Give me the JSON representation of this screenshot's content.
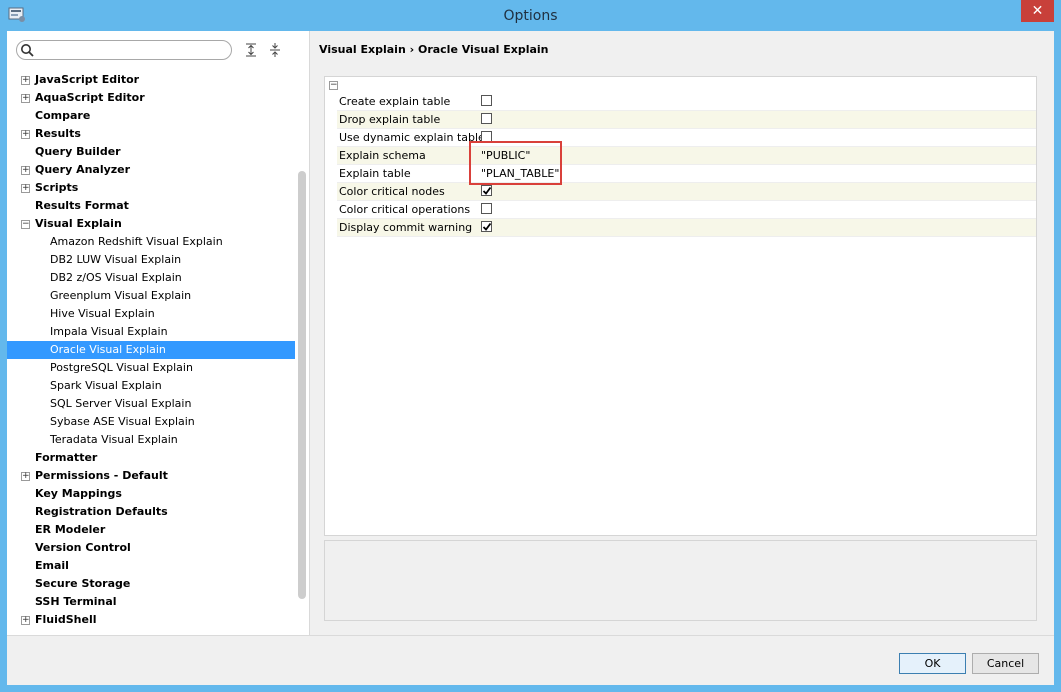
{
  "window": {
    "title": "Options",
    "close_glyph": "✕"
  },
  "search": {
    "placeholder": "",
    "value": ""
  },
  "tree": [
    {
      "label": "JavaScript Editor",
      "level": 0,
      "expander": "+"
    },
    {
      "label": "AquaScript Editor",
      "level": 0,
      "expander": "+"
    },
    {
      "label": "Compare",
      "level": 0,
      "expander": ""
    },
    {
      "label": "Results",
      "level": 0,
      "expander": "+"
    },
    {
      "label": "Query Builder",
      "level": 0,
      "expander": ""
    },
    {
      "label": "Query Analyzer",
      "level": 0,
      "expander": "+"
    },
    {
      "label": "Scripts",
      "level": 0,
      "expander": "+"
    },
    {
      "label": "Results Format",
      "level": 0,
      "expander": ""
    },
    {
      "label": "Visual Explain",
      "level": 0,
      "expander": "−"
    },
    {
      "label": "Amazon Redshift Visual Explain",
      "level": 1,
      "expander": ""
    },
    {
      "label": "DB2 LUW Visual Explain",
      "level": 1,
      "expander": ""
    },
    {
      "label": "DB2 z/OS Visual Explain",
      "level": 1,
      "expander": ""
    },
    {
      "label": "Greenplum Visual Explain",
      "level": 1,
      "expander": ""
    },
    {
      "label": "Hive Visual Explain",
      "level": 1,
      "expander": ""
    },
    {
      "label": "Impala Visual Explain",
      "level": 1,
      "expander": ""
    },
    {
      "label": "Oracle Visual Explain",
      "level": 1,
      "expander": "",
      "selected": true
    },
    {
      "label": "PostgreSQL Visual Explain",
      "level": 1,
      "expander": ""
    },
    {
      "label": "Spark Visual Explain",
      "level": 1,
      "expander": ""
    },
    {
      "label": "SQL Server Visual Explain",
      "level": 1,
      "expander": ""
    },
    {
      "label": "Sybase ASE Visual Explain",
      "level": 1,
      "expander": ""
    },
    {
      "label": "Teradata Visual Explain",
      "level": 1,
      "expander": ""
    },
    {
      "label": "Formatter",
      "level": 0,
      "expander": ""
    },
    {
      "label": "Permissions - Default",
      "level": 0,
      "expander": "+"
    },
    {
      "label": "Key Mappings",
      "level": 0,
      "expander": ""
    },
    {
      "label": "Registration Defaults",
      "level": 0,
      "expander": ""
    },
    {
      "label": "ER Modeler",
      "level": 0,
      "expander": ""
    },
    {
      "label": "Version Control",
      "level": 0,
      "expander": ""
    },
    {
      "label": "Email",
      "level": 0,
      "expander": ""
    },
    {
      "label": "Secure Storage",
      "level": 0,
      "expander": ""
    },
    {
      "label": "SSH Terminal",
      "level": 0,
      "expander": ""
    },
    {
      "label": "FluidShell",
      "level": 0,
      "expander": "+"
    }
  ],
  "breadcrumb": "Visual Explain  ›  Oracle Visual Explain",
  "grid": {
    "collapse_glyph": "−",
    "rows": [
      {
        "name": "Create explain table",
        "type": "checkbox",
        "checked": false
      },
      {
        "name": "Drop explain table",
        "type": "checkbox",
        "checked": false
      },
      {
        "name": "Use dynamic explain table",
        "type": "checkbox",
        "checked": false
      },
      {
        "name": "Explain schema",
        "type": "text",
        "value": "\"PUBLIC\""
      },
      {
        "name": "Explain table",
        "type": "text",
        "value": "\"PLAN_TABLE\""
      },
      {
        "name": "Color critical nodes",
        "type": "checkbox",
        "checked": true
      },
      {
        "name": "Color critical operations",
        "type": "checkbox",
        "checked": false
      },
      {
        "name": "Display commit warning",
        "type": "checkbox",
        "checked": true
      }
    ]
  },
  "buttons": {
    "ok": "OK",
    "cancel": "Cancel"
  },
  "colors": {
    "selection": "#3399ff",
    "highlight_box": "#d9403a",
    "title_bar": "#63b8ec"
  }
}
